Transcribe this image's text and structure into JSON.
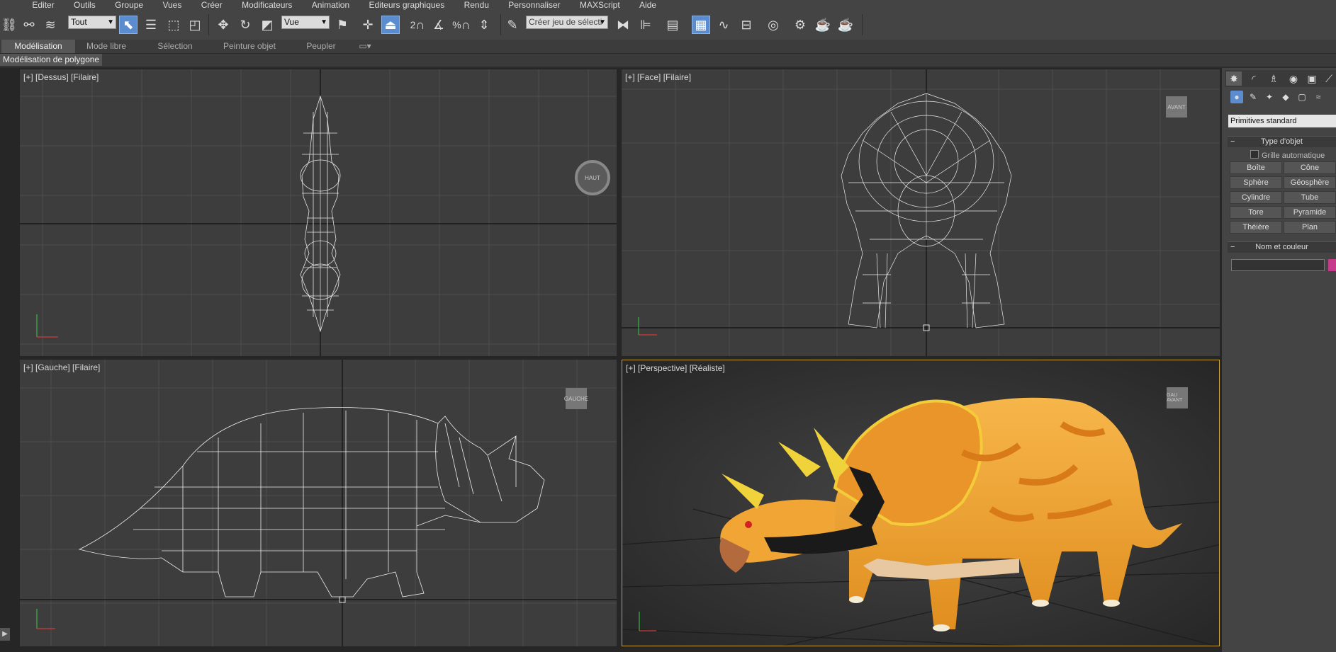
{
  "menubar": {
    "items": [
      "Editer",
      "Outils",
      "Groupe",
      "Vues",
      "Créer",
      "Modificateurs",
      "Animation",
      "Editeurs graphiques",
      "Rendu",
      "Personnaliser",
      "MAXScript",
      "Aide"
    ]
  },
  "toolbar": {
    "selection_filter": "Tout",
    "reference_coord": "Vue",
    "selection_set_placeholder": "Créer jeu de sélecti",
    "snap_labels": [
      "2",
      "%"
    ]
  },
  "ribbon": {
    "tabs": [
      "Modélisation",
      "Mode libre",
      "Sélection",
      "Peinture objet",
      "Peupler"
    ],
    "active_tab": "Modélisation",
    "sub_label": "Modélisation de polygone"
  },
  "viewports": {
    "top": {
      "label": "[+] [Dessus] [Filaire]",
      "navcube": "HAUT"
    },
    "front": {
      "label": "[+] [Face] [Filaire]",
      "navcube": "AVANT"
    },
    "left": {
      "label": "[+] [Gauche] [Filaire]",
      "navcube": "GAUCHE"
    },
    "perspective": {
      "label": "[+] [Perspective] [Réaliste]",
      "navcube": "GAU AVANT"
    }
  },
  "command_panel": {
    "category_dropdown": "Primitives standard",
    "rollout_object_type": "Type d'objet",
    "auto_grid_label": "Grille automatique",
    "buttons": [
      "Boîte",
      "Cône",
      "Sphère",
      "Géosphère",
      "Cylindre",
      "Tube",
      "Tore",
      "Pyramide",
      "Théière",
      "Plan"
    ],
    "rollout_name_color": "Nom et couleur",
    "object_color": "#c53a8a"
  },
  "colors": {
    "accent": "#5a8ccf",
    "viewport_bg": "#3d3d3d",
    "dino_orange": "#f0a030",
    "active_viewport_border": "#c8a23c"
  }
}
